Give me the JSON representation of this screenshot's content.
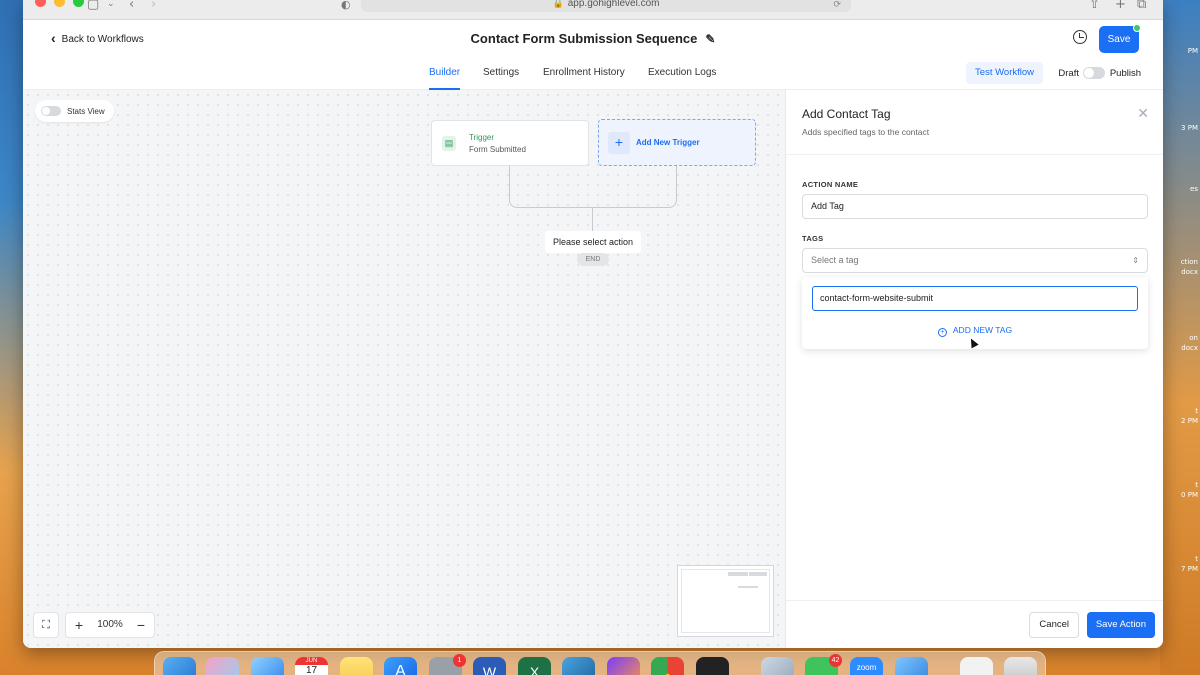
{
  "browser": {
    "url": "app.gohighlevel.com"
  },
  "header": {
    "back_label": "Back to Workflows",
    "workflow_title": "Contact Form Submission Sequence",
    "save_label": "Save"
  },
  "tabs": [
    {
      "label": "Builder",
      "active": true
    },
    {
      "label": "Settings",
      "active": false
    },
    {
      "label": "Enrollment History",
      "active": false
    },
    {
      "label": "Execution Logs",
      "active": false
    }
  ],
  "toolbar": {
    "test_workflow_label": "Test Workflow",
    "draft_label": "Draft",
    "publish_label": "Publish"
  },
  "canvas": {
    "stats_view_label": "Stats View",
    "trigger": {
      "title": "Trigger",
      "subtitle": "Form Submitted"
    },
    "add_trigger_label": "Add New Trigger",
    "select_action_label": "Please select action",
    "end_label": "END",
    "zoom_level": "100%"
  },
  "panel": {
    "title": "Add Contact Tag",
    "subtitle": "Adds specified tags to the contact",
    "action_name_label": "ACTION NAME",
    "action_name_value": "Add Tag",
    "tags_label": "TAGS",
    "tags_placeholder": "Select a tag",
    "new_tag_value": "contact-form-website-submit",
    "add_new_tag_label": "ADD NEW TAG",
    "cancel_label": "Cancel",
    "save_action_label": "Save Action"
  },
  "dock": {
    "calendar_month": "JUN",
    "calendar_day": "17",
    "badge_settings": "1",
    "badge_messages": "42",
    "zoom_app_label": "zoom"
  },
  "desktop_labels": [
    "PM",
    "3 PM",
    "es",
    "ction",
    "docx",
    "on",
    "docx",
    "t",
    "2 PM",
    "t",
    "0 PM",
    "t",
    "7 PM"
  ],
  "colors": {
    "accent": "#1a6ff5",
    "trigger_green": "#2e9a5b"
  }
}
